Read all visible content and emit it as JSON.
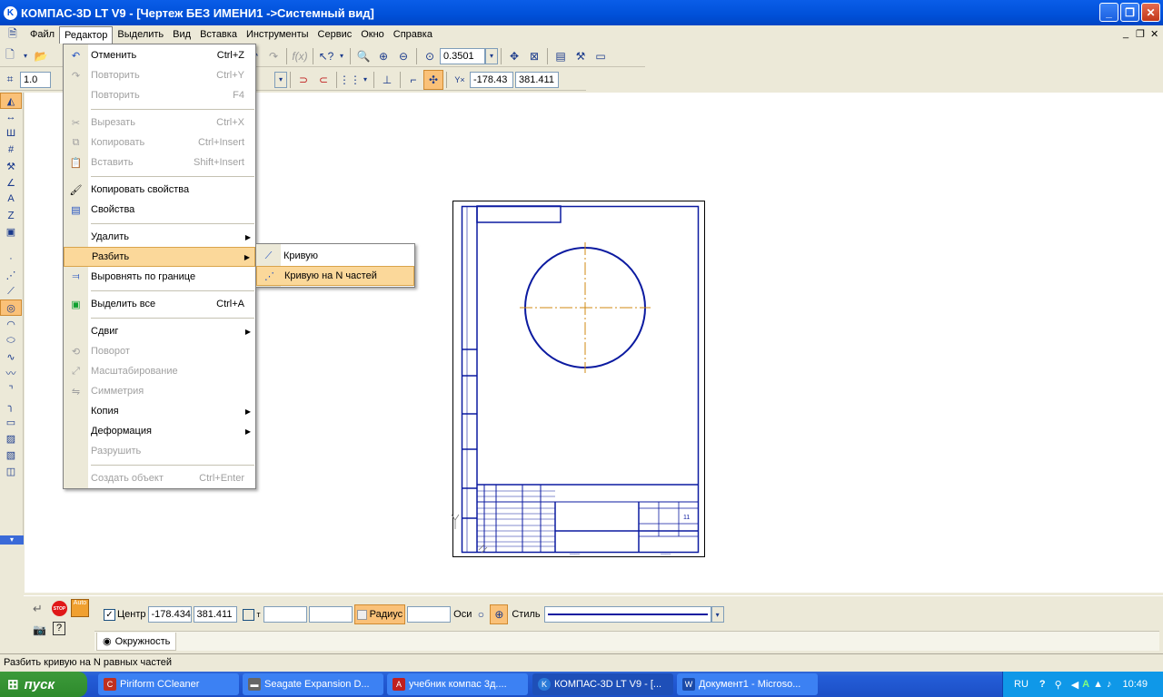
{
  "window": {
    "title": "КОМПАС-3D LT V9 - [Чертеж БЕЗ ИМЕНИ1 ->Системный вид]",
    "minimize": "_",
    "restore": "❐",
    "close": "✕",
    "doc_minimize": "_",
    "doc_restore": "❐",
    "doc_close": "✕"
  },
  "menu": [
    "Файл",
    "Редактор",
    "Выделить",
    "Вид",
    "Вставка",
    "Инструменты",
    "Сервис",
    "Окно",
    "Справка"
  ],
  "toolbar": {
    "zoom": "0.3501",
    "coord_x": "-178.43",
    "coord_y": "381.411",
    "step": "1.0",
    "coord_label": "Y×"
  },
  "dropdown": [
    {
      "label": "Отменить",
      "shortcut": "Ctrl+Z",
      "enabled": true,
      "icon": "undo-icon"
    },
    {
      "label": "Повторить",
      "shortcut": "Ctrl+Y",
      "enabled": false,
      "icon": "redo-icon"
    },
    {
      "label": "Повторить",
      "shortcut": "F4",
      "enabled": false,
      "icon": ""
    },
    {
      "label": "Вырезать",
      "shortcut": "Ctrl+X",
      "enabled": false,
      "icon": "cut-icon"
    },
    {
      "label": "Копировать",
      "shortcut": "Ctrl+Insert",
      "enabled": false,
      "icon": "copy-icon"
    },
    {
      "label": "Вставить",
      "shortcut": "Shift+Insert",
      "enabled": false,
      "icon": "paste-icon"
    },
    {
      "label": "Копировать свойства",
      "shortcut": "",
      "enabled": true,
      "icon": "brush-icon"
    },
    {
      "label": "Свойства",
      "shortcut": "",
      "enabled": true,
      "icon": "properties-icon"
    },
    {
      "label": "Удалить",
      "shortcut": "",
      "enabled": true,
      "icon": "",
      "submenu": true
    },
    {
      "label": "Разбить",
      "shortcut": "",
      "enabled": true,
      "icon": "",
      "submenu": true,
      "highlighted": true
    },
    {
      "label": "Выровнять по границе",
      "shortcut": "",
      "enabled": true,
      "icon": "align-icon"
    },
    {
      "label": "Выделить все",
      "shortcut": "Ctrl+A",
      "enabled": true,
      "icon": "select-all-icon"
    },
    {
      "label": "Сдвиг",
      "shortcut": "",
      "enabled": true,
      "icon": "",
      "submenu": true
    },
    {
      "label": "Поворот",
      "shortcut": "",
      "enabled": false,
      "icon": "rotate-icon"
    },
    {
      "label": "Масштабирование",
      "shortcut": "",
      "enabled": false,
      "icon": "scale-icon"
    },
    {
      "label": "Симметрия",
      "shortcut": "",
      "enabled": false,
      "icon": "symmetry-icon"
    },
    {
      "label": "Копия",
      "shortcut": "",
      "enabled": true,
      "icon": "",
      "submenu": true
    },
    {
      "label": "Деформация",
      "shortcut": "",
      "enabled": true,
      "icon": "",
      "submenu": true
    },
    {
      "label": "Разрушить",
      "shortcut": "",
      "enabled": false,
      "icon": ""
    },
    {
      "label": "Создать объект",
      "shortcut": "Ctrl+Enter",
      "enabled": false,
      "icon": ""
    }
  ],
  "submenu": [
    {
      "label": "Кривую",
      "icon": "split-curve-icon",
      "highlighted": false
    },
    {
      "label": "Кривую на N частей",
      "icon": "split-curve-n-icon",
      "highlighted": true
    }
  ],
  "props": {
    "stop": "STOP",
    "auto": "Auto",
    "center_label": "Центр",
    "center_x": "-178.434",
    "center_y": "381.411",
    "t_label": "т",
    "radius_label": "Радиус",
    "axes_label": "Оси",
    "style_label": "Стиль",
    "tab": "Окружность"
  },
  "status": "Разбить кривую на N равных частей",
  "taskbar": {
    "start": "пуск",
    "tasks": [
      "Piriform CCleaner",
      "Seagate Expansion D...",
      "учебник компас 3д....",
      "КОМПАС-3D LT V9 - [...",
      "Документ1 - Microso..."
    ],
    "lang": "RU",
    "time": "10:49"
  },
  "colors": {
    "accent": "#0054e3",
    "highlight": "#fbd89a",
    "drawing": "#0b1aa0",
    "axis": "#d08a10"
  }
}
